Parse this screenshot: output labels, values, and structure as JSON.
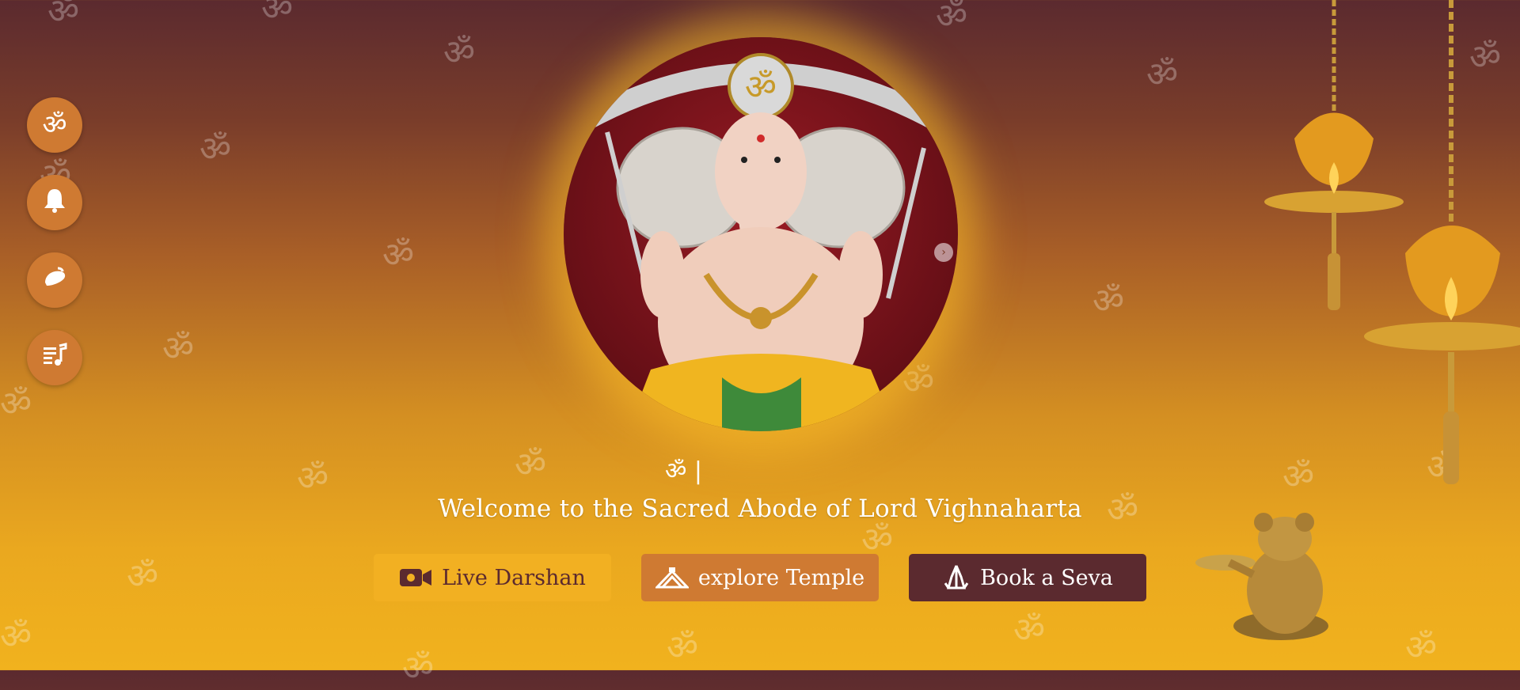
{
  "background_symbol": "ॐ",
  "side_rail": [
    {
      "icon": "om-icon",
      "glyph": "ॐ"
    },
    {
      "icon": "bell-icon",
      "glyph": "🔔"
    },
    {
      "icon": "conch-icon",
      "glyph": "🐚"
    },
    {
      "icon": "music-playlist-icon",
      "glyph": "♬"
    }
  ],
  "carousel": {
    "next_glyph": "›"
  },
  "mantra_line": "ॐ |",
  "welcome_text": "Welcome to the Sacred Abode of Lord Vighnaharta",
  "actions": {
    "live_darshan": "Live Darshan",
    "explore_temple": "explore Temple",
    "book_seva": "Book a Seva"
  },
  "colors": {
    "maroon": "#5b2a2f",
    "saffron": "#f2b022",
    "orange": "#cf7a32",
    "gold": "#eaa81f"
  }
}
